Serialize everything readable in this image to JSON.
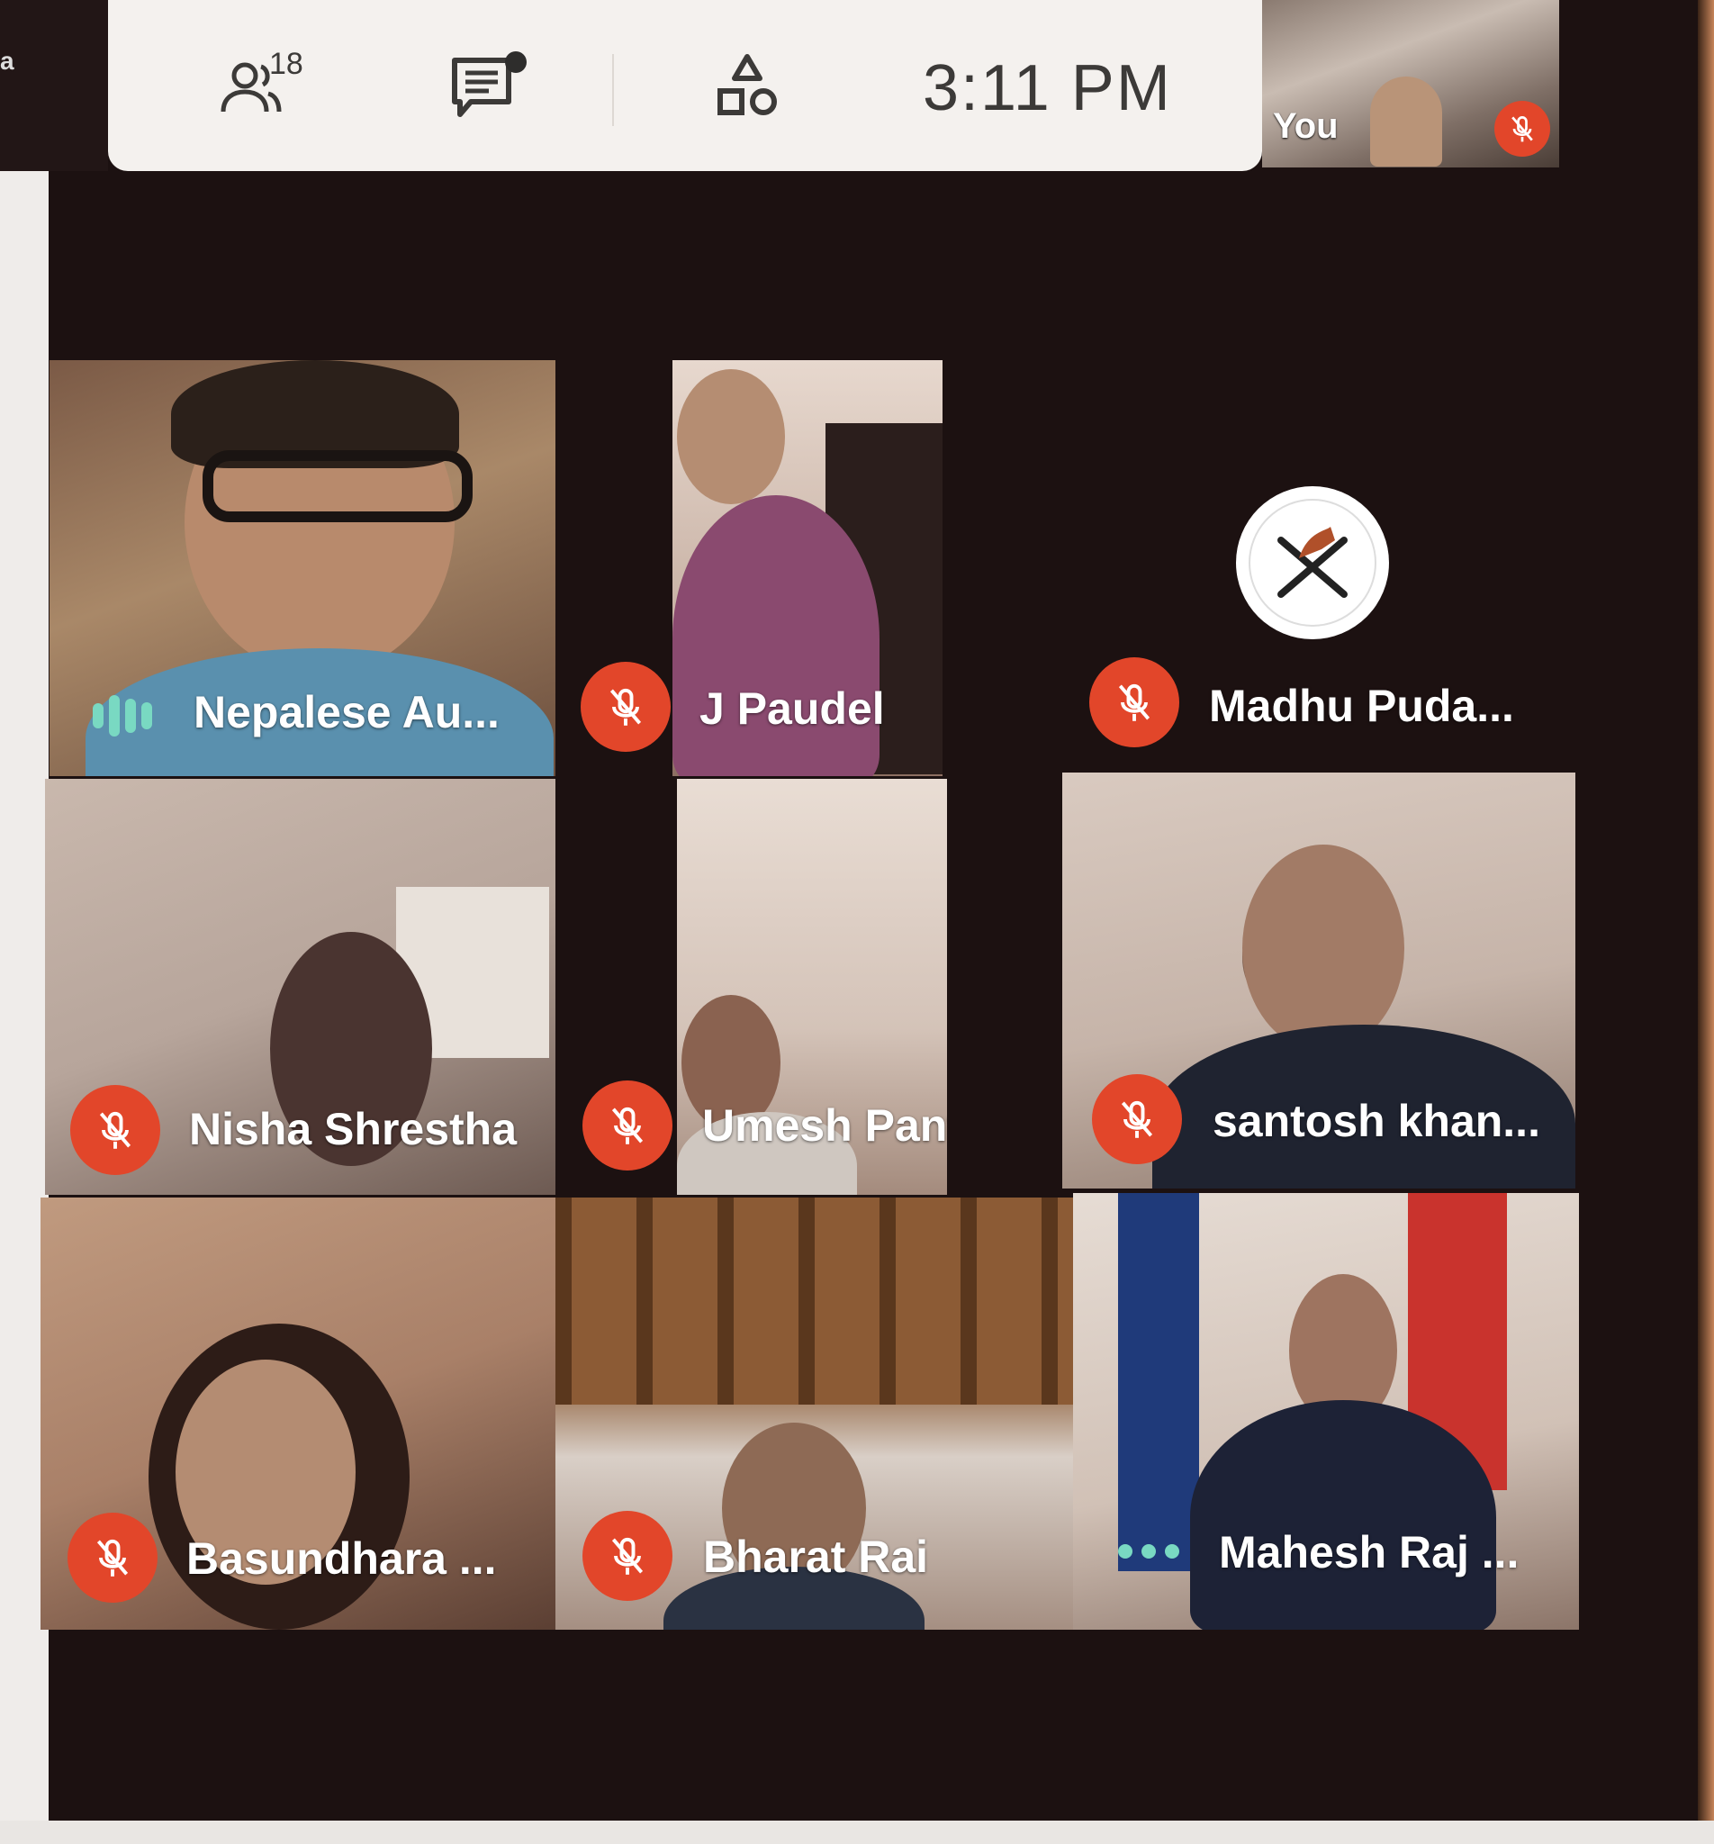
{
  "toolbar": {
    "participant_count": "18",
    "time": "3:11  PM",
    "people_icon": "people-icon",
    "chat_icon": "chat-icon",
    "activities_icon": "activities-icon"
  },
  "self_view": {
    "label": "You",
    "mic_state": "muted"
  },
  "left_edge_text": "a",
  "participants": [
    {
      "name": "Nepalese Au...",
      "status": "speaking"
    },
    {
      "name": "J Paudel",
      "status": "muted"
    },
    {
      "name": "Madhu Puda...",
      "status": "muted"
    },
    {
      "name": "Nisha Shrestha",
      "status": "muted"
    },
    {
      "name": "Umesh Panta",
      "status": "muted"
    },
    {
      "name": "santosh khan...",
      "status": "muted"
    },
    {
      "name": "Basundhara ...",
      "status": "muted"
    },
    {
      "name": "Bharat Rai",
      "status": "muted"
    },
    {
      "name": "Mahesh Raj ...",
      "status": "more-options"
    }
  ],
  "colors": {
    "muted_mic": "#e2462a",
    "speaking_indicator": "#79d9c2",
    "toolbar_bg": "#f4f1ee",
    "grid_bg": "#1c1111"
  }
}
